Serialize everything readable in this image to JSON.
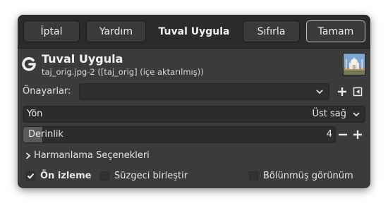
{
  "headerbar": {
    "cancel_label": "İptal",
    "help_label": "Yardım",
    "title": "Tuval Uygula",
    "reset_label": "Sıfırla",
    "ok_label": "Tamam"
  },
  "plugin": {
    "title": "Tuval Uygula",
    "subtitle": "taj_orig.jpg-2 ([taj_orig] (içe aktarılmış))",
    "icon": "gegl-icon",
    "thumbnail": "taj-mahal-thumbnail"
  },
  "presets": {
    "label": "Önayarlar:",
    "value": ""
  },
  "direction": {
    "label": "Yön",
    "value": "Üst sağ"
  },
  "depth": {
    "label": "Derinlik",
    "value": "4",
    "fill_fraction": 0.06
  },
  "blending": {
    "label": "Harmanlama Seçenekleri"
  },
  "checks": {
    "preview_label": "Ön izleme",
    "preview_checked": true,
    "merge_label": "Süzgeci birleştir",
    "merge_checked": false,
    "split_label": "Bölünmüş görünüm",
    "split_checked": false
  }
}
